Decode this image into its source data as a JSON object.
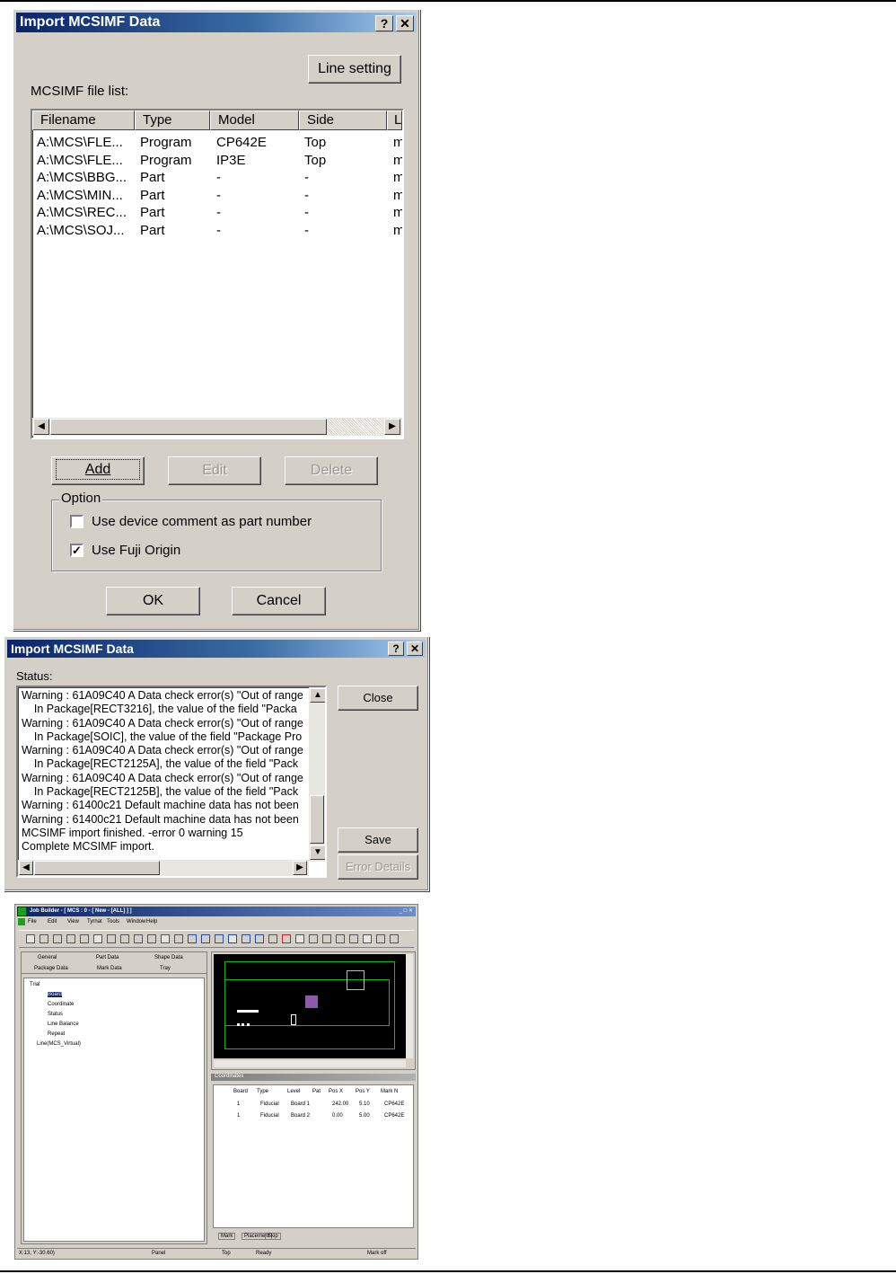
{
  "dialog1": {
    "title": "Import MCSIMF Data",
    "help_btn": "?",
    "close_btn": "✕",
    "line_setting": "Line setting",
    "list_label": "MCSIMF file list:",
    "columns": [
      "Filename",
      "Type",
      "Model",
      "Side",
      "L"
    ],
    "rows": [
      [
        "A:\\MCS\\FLE...",
        "Program",
        "CP642E",
        "Top",
        "m"
      ],
      [
        "A:\\MCS\\FLE...",
        "Program",
        "IP3E",
        "Top",
        "m"
      ],
      [
        "A:\\MCS\\BBG...",
        "Part",
        "-",
        "-",
        "m"
      ],
      [
        "A:\\MCS\\MIN...",
        "Part",
        "-",
        "-",
        "m"
      ],
      [
        "A:\\MCS\\REC...",
        "Part",
        "-",
        "-",
        "m"
      ],
      [
        "A:\\MCS\\SOJ...",
        "Part",
        "-",
        "-",
        "m"
      ]
    ],
    "add": "Add",
    "edit": "Edit",
    "delete": "Delete",
    "option_title": "Option",
    "opt1_label": "Use device comment as part number",
    "opt1_checked": false,
    "opt2_label": "Use Fuji Origin",
    "opt2_checked": true,
    "ok": "OK",
    "cancel": "Cancel"
  },
  "dialog2": {
    "title": "Import MCSIMF Data",
    "help_btn": "?",
    "close_btn": "✕",
    "status_label": "Status:",
    "lines": [
      "Warning : 61A09C40 A Data check error(s) \"Out of range",
      "    In Package[RECT3216], the value of the field \"Packa",
      "Warning : 61A09C40 A Data check error(s) \"Out of range",
      "    In Package[SOIC], the value of the field \"Package Pro",
      "Warning : 61A09C40 A Data check error(s) \"Out of range",
      "    In Package[RECT2125A], the value of the field \"Pack",
      "Warning : 61A09C40 A Data check error(s) \"Out of range",
      "    In Package[RECT2125B], the value of the field \"Pack",
      "Warning : 61400c21 Default machine data has not been",
      "Warning : 61400c21 Default machine data has not been",
      "MCSIMF import finished. -error 0 warning 15",
      "Complete MCSIMF import."
    ],
    "close": "Close",
    "save": "Save",
    "error_details": "Error Details"
  },
  "jobbuilder": {
    "title": "Job Builder - [ MCS : 0 - [ New - [ALL] ] ]",
    "menu": [
      "File",
      "Edit",
      "View",
      "Tyrnat",
      "Tools",
      "Window",
      "Help"
    ],
    "tabs_row1": [
      "General",
      "Part Data",
      "Shape Data"
    ],
    "tabs_row2": [
      "Package Data",
      "Mark Data",
      "Tray"
    ],
    "tree": [
      "Trial",
      "Board",
      "Coordinate",
      "Status",
      "Line Balance",
      "Repeat",
      "Line(MCS_Virtual)"
    ],
    "coord_header": "Coordinates",
    "table_cols": [
      "Board",
      "Type",
      "Level",
      "Pat",
      "Pos X",
      "Pos Y",
      "Mark N"
    ],
    "table_rows": [
      [
        "1",
        "Fiducial",
        "Board 1",
        "",
        "242.00",
        "5.10",
        "CP642E"
      ],
      [
        "1",
        "Fiducial",
        "Board 2",
        "",
        "0.00",
        "5.00",
        "CP642E"
      ]
    ],
    "bottom_tabs": [
      "Mark",
      "Placement",
      "Skip"
    ],
    "status": [
      "X:13, Y:-30.60)",
      "Panel",
      "Top",
      "Ready",
      "Mark off"
    ]
  }
}
